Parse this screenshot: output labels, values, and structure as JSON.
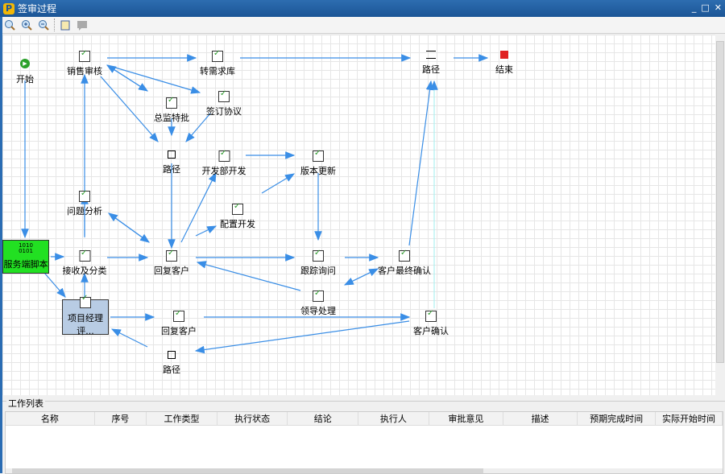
{
  "window": {
    "title": "签审过程",
    "logo": "P",
    "controls": [
      "_",
      "□",
      "✕"
    ]
  },
  "toolbar": [
    {
      "icon": "zoom-fit-icon"
    },
    {
      "icon": "zoom-in-icon"
    },
    {
      "icon": "zoom-out-icon"
    },
    {
      "icon": "properties-icon"
    },
    {
      "icon": "comment-icon"
    }
  ],
  "nodes": {
    "start": "开始",
    "xs": "销售审核",
    "zxk": "转需求库",
    "zj": "总监特批",
    "qd": "签订协议",
    "lj1": "路径",
    "kf": "开发部开发",
    "bb": "版本更新",
    "pz": "配置开发",
    "wt": "问题分析",
    "fw": "服务端脚本",
    "js": "接收及分类",
    "hf1": "回复客户",
    "gz": "跟踪询问",
    "zz": "客户最终确认",
    "ld": "领导处理",
    "xm": "项目经理评...",
    "hf2": "回复客户",
    "kh": "客户确认",
    "lj3": "路径",
    "lj2": "路径",
    "end": "结束"
  },
  "colors": {
    "edge": "#3a8ee6",
    "server_node": "#22e022",
    "selected_node": "#b8cce4",
    "end": "#e02020",
    "start": "#2aa02a"
  },
  "worklist": {
    "title": "工作列表",
    "columns": [
      "名称",
      "序号",
      "工作类型",
      "执行状态",
      "结论",
      "执行人",
      "审批意见",
      "描述",
      "预期完成时间",
      "实际开始时间"
    ]
  }
}
